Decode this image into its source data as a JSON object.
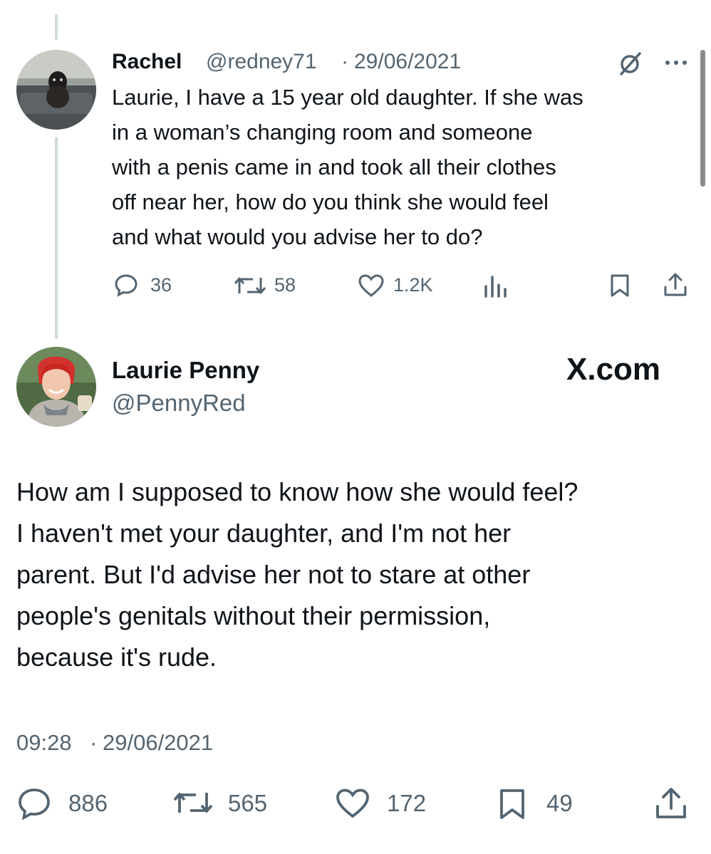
{
  "reply_tweet": {
    "display_name": "Rachel",
    "handle": "@redney71",
    "separator": "·",
    "date": "29/06/2021",
    "text_lines": [
      "Laurie, I have a 15 year old daughter. If she was",
      "in a woman’s changing room and someone",
      "with a penis came in  and took all their clothes",
      "off near her, how do you think she would feel",
      "and what would you advise her to do?"
    ],
    "replies": "36",
    "retweets": "58",
    "likes": "1.2K"
  },
  "main_tweet": {
    "display_name": "Laurie Penny",
    "handle": "@PennyRed",
    "watermark": "X.com",
    "text_lines": [
      "How am I supposed to know how she would feel?",
      "I haven't met your daughter, and I'm not her",
      "parent. But I'd advise her not to stare at other",
      "people's genitals without their permission,",
      "because it's rude."
    ],
    "time": "09:28",
    "separator": "·",
    "date": "29/06/2021",
    "replies": "886",
    "retweets": "565",
    "likes": "172",
    "bookmarks": "49"
  },
  "icons": [
    "reply-icon",
    "retweet-icon",
    "like-icon",
    "views-icon",
    "bookmark-icon",
    "share-icon",
    "grok-icon",
    "more-icon"
  ],
  "colors": {
    "text": "#0f1419",
    "muted": "#536471",
    "thread_line": "#cfd9de"
  }
}
